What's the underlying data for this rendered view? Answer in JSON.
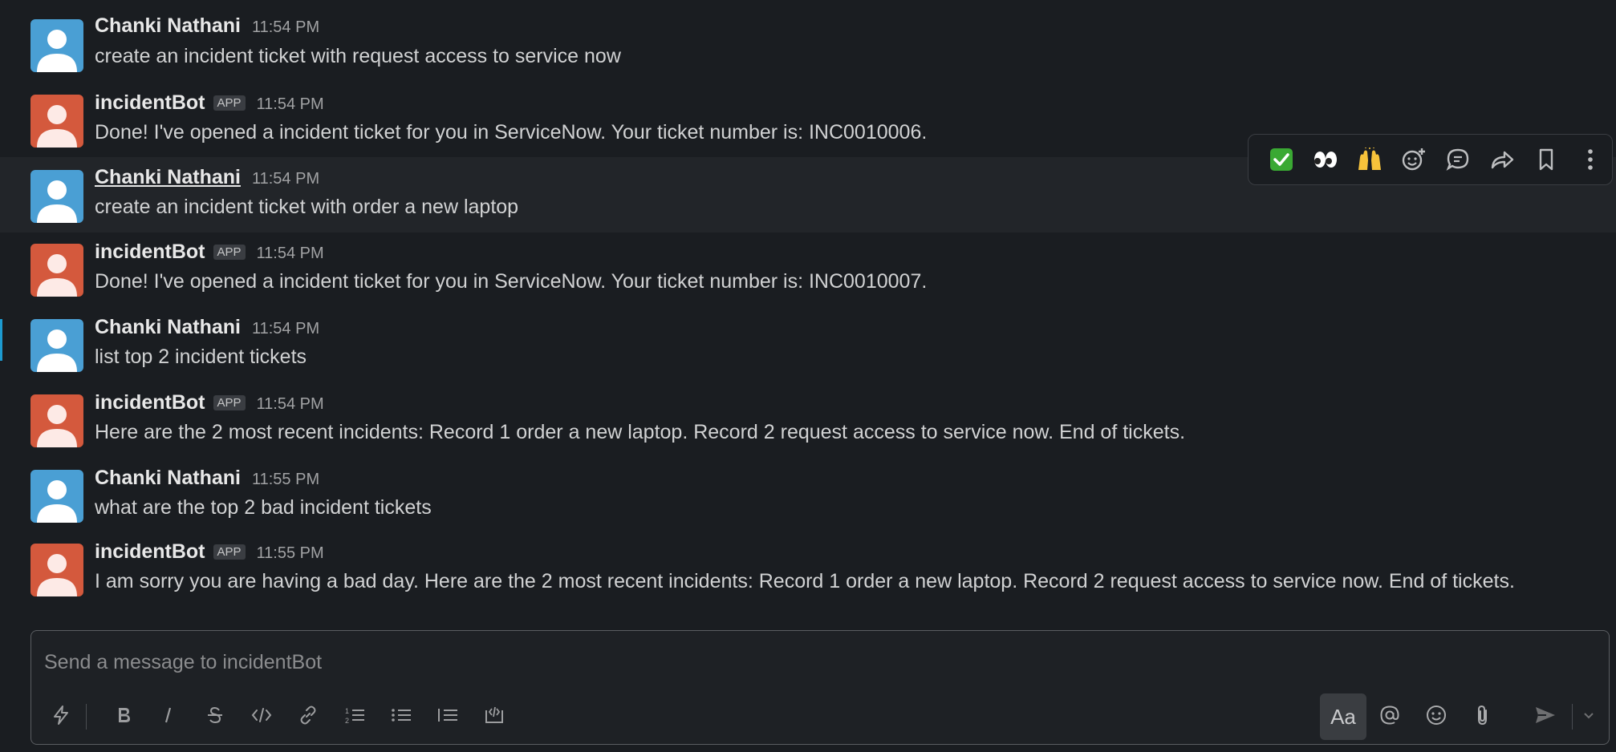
{
  "messages": [
    {
      "author": "Chanki Nathani",
      "time": "11:54 PM",
      "text": "create an incident ticket with request access to service now"
    },
    {
      "author": "incidentBot",
      "badge": "APP",
      "time": "11:54 PM",
      "text": "Done! I've opened a incident ticket for you in ServiceNow. Your ticket number is: INC0010006."
    },
    {
      "author": "Chanki Nathani",
      "time": "11:54 PM",
      "text": "create an incident ticket with order a new laptop"
    },
    {
      "author": "incidentBot",
      "badge": "APP",
      "time": "11:54 PM",
      "text": "Done! I've opened a incident ticket for you in ServiceNow. Your ticket number is: INC0010007."
    },
    {
      "author": "Chanki Nathani",
      "time": "11:54 PM",
      "text": "list top 2 incident tickets"
    },
    {
      "author": "incidentBot",
      "badge": "APP",
      "time": "11:54 PM",
      "text": "Here are the 2 most recent incidents: Record 1 order a new laptop. Record 2 request access to service now. End of tickets."
    },
    {
      "author": "Chanki Nathani",
      "time": "11:55 PM",
      "text": "what are the top 2 bad incident tickets"
    },
    {
      "author": "incidentBot",
      "badge": "APP",
      "time": "11:55 PM",
      "text": "I am sorry you are having a bad day. Here are the 2 most recent incidents: Record 1 order a new laptop. Record 2 request access to service now. End of tickets."
    }
  ],
  "hover_toolbar": {
    "icons": [
      "white-check-mark-emoji",
      "eyes-emoji",
      "raised-hands-emoji",
      "add-reaction-icon",
      "reply-in-thread-icon",
      "share-icon",
      "bookmark-icon",
      "more-actions-icon"
    ],
    "emoji": {
      "check": "✅",
      "eyes": "👀",
      "hands": "🙌"
    }
  },
  "composer": {
    "placeholder": "Send a message to incidentBot",
    "value": "",
    "aa_label": "Aa"
  },
  "colors": {
    "background": "#1a1d21",
    "user_avatar": "#4a9fd4",
    "bot_avatar": "#d4593d",
    "check_green": "#3aa933"
  }
}
